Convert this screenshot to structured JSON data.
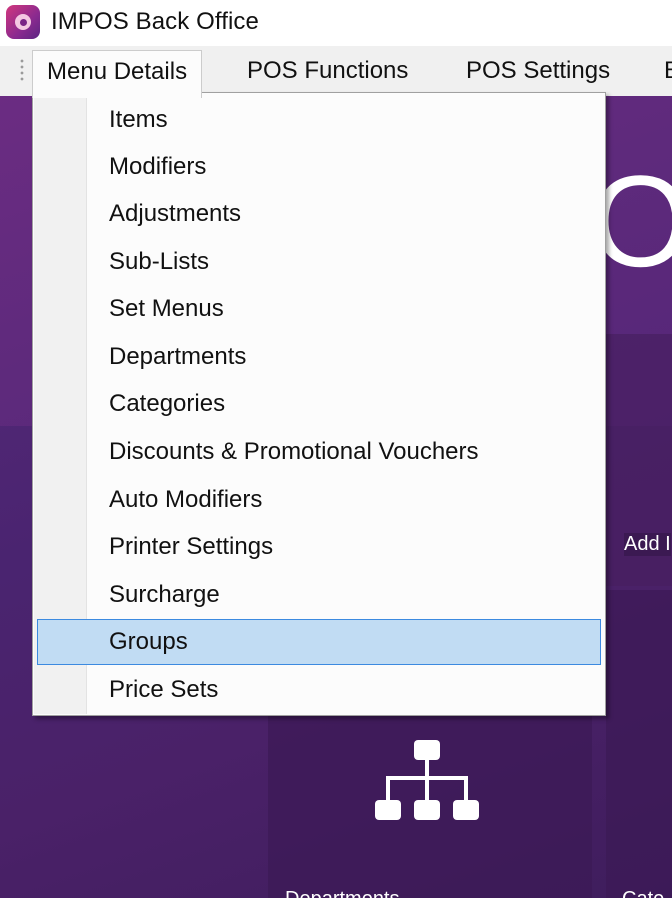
{
  "window": {
    "title": "IMPOS Back Office"
  },
  "menubar": {
    "items": [
      {
        "label": "Menu Details",
        "active": true
      },
      {
        "label": "POS Functions",
        "active": false
      },
      {
        "label": "POS Settings",
        "active": false
      },
      {
        "label": "B",
        "active": false
      }
    ]
  },
  "dropdown": {
    "items": [
      {
        "label": "Items"
      },
      {
        "label": "Modifiers"
      },
      {
        "label": "Adjustments"
      },
      {
        "label": "Sub-Lists"
      },
      {
        "label": "Set Menus"
      },
      {
        "label": "Departments"
      },
      {
        "label": "Categories"
      },
      {
        "label": "Discounts & Promotional Vouchers"
      },
      {
        "label": "Auto Modifiers"
      },
      {
        "label": "Printer Settings"
      },
      {
        "label": "Surcharge"
      },
      {
        "label": "Groups",
        "selected": true
      },
      {
        "label": "Price Sets"
      }
    ]
  },
  "dashboard": {
    "banner_text": "Of",
    "add_tile_label": "Add I",
    "departments_tile_label": "Departments",
    "categories_tile_label": "Cate",
    "departments_icon": "hierarchy-icon"
  },
  "colors": {
    "dashboard_purple": "#4a2470",
    "selection_fill": "#c1dcf3",
    "selection_border": "#3c8ae0",
    "menu_bar": "#f0f0f0"
  }
}
